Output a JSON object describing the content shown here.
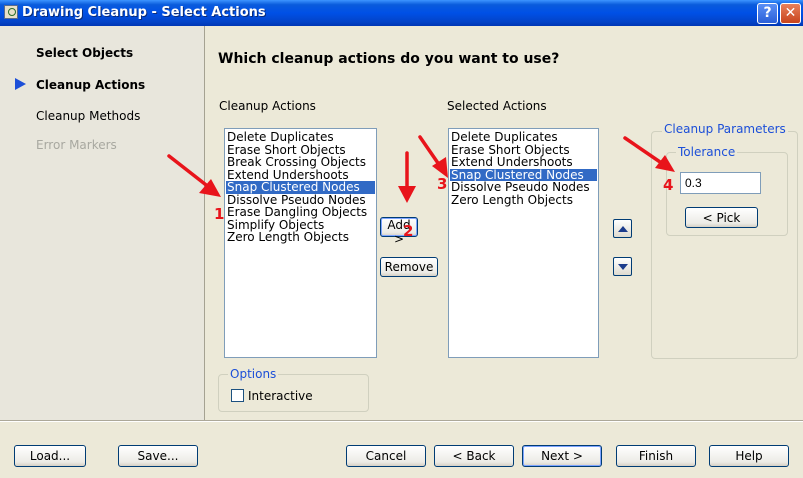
{
  "window": {
    "title": "Drawing Cleanup - Select Actions",
    "help_label": "?",
    "close_label": "✕"
  },
  "sidebar": {
    "items": [
      {
        "label": "Select Objects",
        "state": "completed"
      },
      {
        "label": "Cleanup Actions",
        "state": "current"
      },
      {
        "label": "Cleanup Methods",
        "state": "pending"
      },
      {
        "label": "Error Markers",
        "state": "disabled"
      }
    ]
  },
  "main": {
    "heading": "Which cleanup actions do you want to use?",
    "available": {
      "label": "Cleanup Actions",
      "items": [
        "Delete Duplicates",
        "Erase Short Objects",
        "Break Crossing Objects",
        "Extend Undershoots",
        "Snap Clustered Nodes",
        "Dissolve Pseudo Nodes",
        "Erase Dangling Objects",
        "Simplify Objects",
        "Zero Length Objects"
      ],
      "selected_index": 4
    },
    "add_label": "Add >",
    "remove_label": "Remove",
    "selected": {
      "label": "Selected Actions",
      "items": [
        "Delete Duplicates",
        "Erase Short Objects",
        "Extend Undershoots",
        "Snap Clustered Nodes",
        "Dissolve Pseudo Nodes",
        "Zero Length Objects"
      ],
      "selected_index": 3
    },
    "parameters": {
      "title": "Cleanup Parameters",
      "tolerance_title": "Tolerance",
      "tolerance_value": "0.3",
      "pick_label": "< Pick"
    },
    "options": {
      "title": "Options",
      "interactive_label": "Interactive",
      "interactive_checked": false
    }
  },
  "footer": {
    "load_label": "Load...",
    "save_label": "Save...",
    "cancel_label": "Cancel",
    "back_label": "< Back",
    "next_label": "Next >",
    "finish_label": "Finish",
    "help_label": "Help"
  },
  "annotations": {
    "numbers": [
      "1",
      "2",
      "3",
      "4"
    ],
    "color": "#e8141b"
  },
  "colors": {
    "titlebar": "#0050e6",
    "selection": "#316ac5",
    "group_title": "#1c4fd8"
  }
}
